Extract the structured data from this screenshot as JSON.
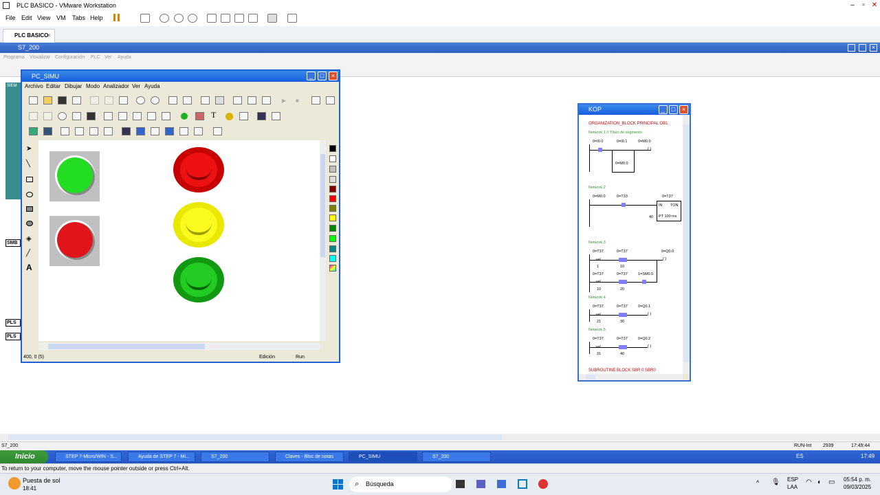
{
  "vmware": {
    "title": "PLC BASICO - VMware Workstation",
    "menu": [
      "File",
      "Edit",
      "View",
      "VM",
      "Tabs",
      "Help"
    ],
    "tab": "PLC BASICO"
  },
  "s7": {
    "window_title": "S7_200",
    "menu": [
      "Programa",
      "Visualizar",
      "Configuración",
      "PLC",
      "Ver",
      "Ayuda"
    ],
    "left_labels": [
      "SMB",
      "PLS",
      "PLS"
    ],
    "left_top": "SIEM"
  },
  "pcsimu": {
    "title": "PC_SIMU",
    "menu": [
      "Archivo",
      "Editar",
      "Dibujar",
      "Modo",
      "Analizador",
      "Ver",
      "Ayuda"
    ],
    "text_tool": "T",
    "a_tool": "A",
    "status": {
      "coords": "400, 0 (5)",
      "mode": "Edición",
      "run": "Run"
    }
  },
  "kop": {
    "title": "KOP",
    "header": "ORGANIZATION_BLOCK PRINCIPAL:OB1",
    "footer": "SUBROUTINE BLOCK SBR 0:SBR0",
    "net1": {
      "label": "Network 1 // Título de segmento",
      "c1": "0=I0.0",
      "c2": "0=I0.1",
      "coil": "0=M0.0",
      "par": "0=M0.0"
    },
    "net2": {
      "label": "Network 2",
      "c1": "0=M0.0",
      "c2": "0=T33",
      "box": "0=T37",
      "in": "IN",
      "ton": "TON",
      "pt_val": "40",
      "pt": "PT 100 ms"
    },
    "net3": {
      "label": "Network 3",
      "a1": "0=T37",
      "a2": "0=T37",
      "coil": "0=Q0.0",
      "v1": "1",
      "v2": "10",
      "b1": "0=T37",
      "b2": "0=T37",
      "b3": "1=SM0.5",
      "v3": "10",
      "v4": "20"
    },
    "net4": {
      "label": "Network 4",
      "a1": "0=T37",
      "a2": "0=T37",
      "coil": "0=Q0.1",
      "v1": "21",
      "v2": "30"
    },
    "net5": {
      "label": "Network 5",
      "a1": "0=T37",
      "a2": "0=T37",
      "coil": "0=Q0.2",
      "v1": "31",
      "v2": "40"
    },
    "cmp": ">=I"
  },
  "guest_status": {
    "left": "S7_200",
    "run": "RUN-Int",
    "num": "2939",
    "time": "17:49:44"
  },
  "taskbar": {
    "start": "Inicio",
    "items": [
      "STEP 7-Micro/WIN - S...",
      "Ayuda de STEP 7 - Mi...",
      "S7_200",
      "Claves - Bloc de notas",
      "PC_SIMU",
      "S7_200"
    ],
    "lang": "ES",
    "clock": "17:49"
  },
  "hint": "To return to your computer, move the mouse pointer outside or press Ctrl+Alt.",
  "host": {
    "weather_title": "Puesta de sol",
    "weather_time": "18:41",
    "search": "Búsqueda",
    "lang1": "ESP",
    "lang2": "LAA",
    "time": "05:54 p. m.",
    "date": "09/03/2025"
  }
}
